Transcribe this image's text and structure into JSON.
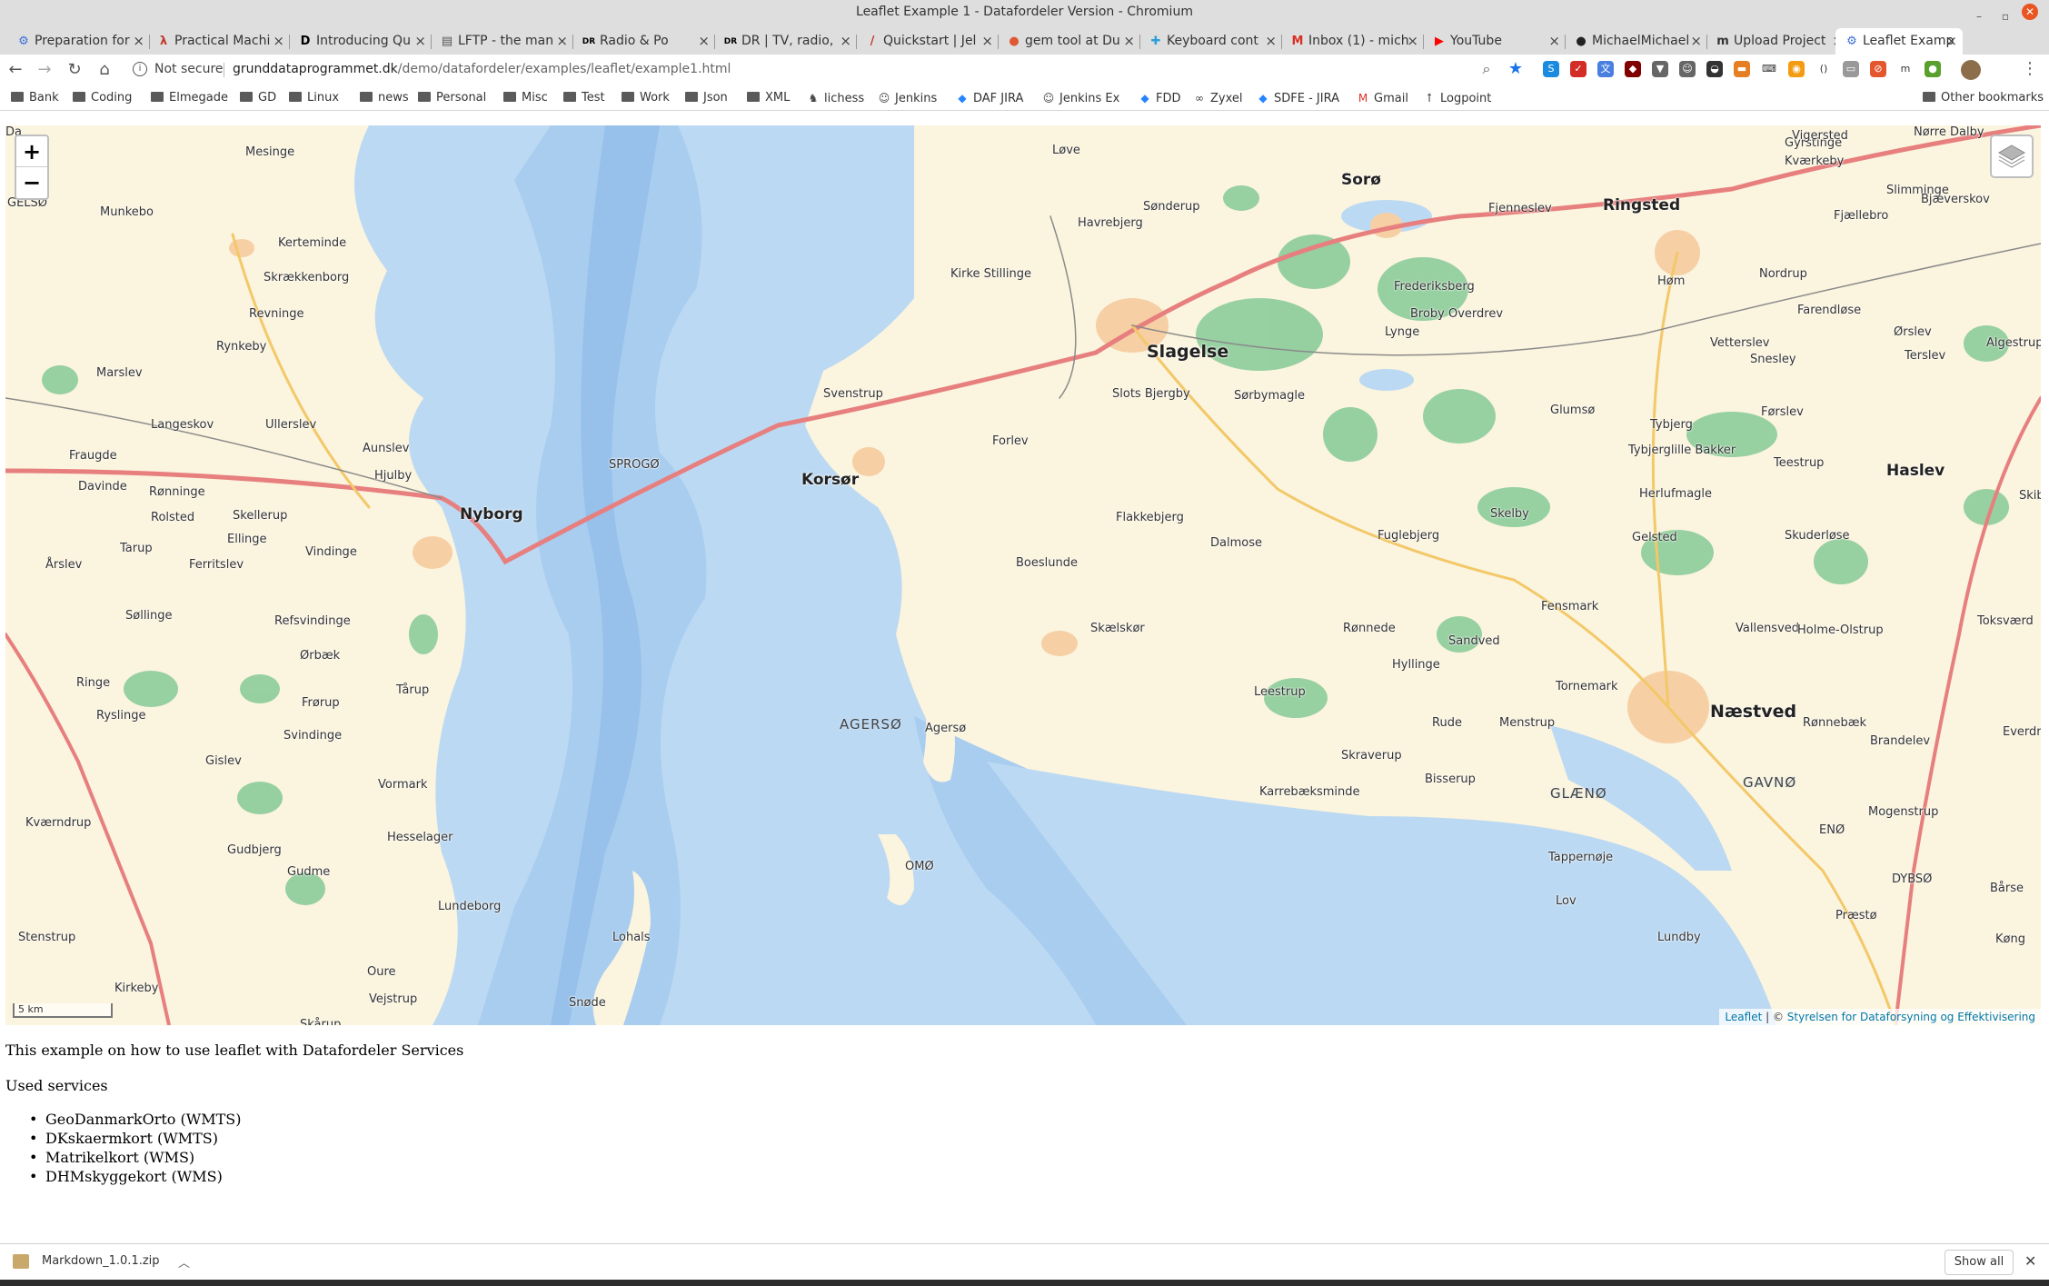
{
  "window": {
    "title": "Leaflet Example 1 - Datafordeler Version - Chromium"
  },
  "tabs": [
    {
      "label": "Preparation for",
      "icon": "gear-icon",
      "icon_glyph": "⚙",
      "icon_color": "#3b6fd8"
    },
    {
      "label": "Practical Machi",
      "icon": "lambda-icon",
      "icon_glyph": "λ",
      "icon_color": "#c0392b"
    },
    {
      "label": "Introducing Qu",
      "icon": "dev-icon",
      "icon_glyph": "D",
      "icon_color": "#000000"
    },
    {
      "label": "LFTP - the man",
      "icon": "terminal-icon",
      "icon_glyph": "▤",
      "icon_color": "#555555"
    },
    {
      "label": "Radio & Po",
      "icon": "dr-icon",
      "icon_glyph": "DR",
      "icon_color": "#000000"
    },
    {
      "label": "DR | TV, radio,",
      "icon": "dr-icon",
      "icon_glyph": "DR",
      "icon_color": "#000000"
    },
    {
      "label": "Quickstart | Jel",
      "icon": "jekyll-icon",
      "icon_glyph": "/",
      "icon_color": "#c0392b"
    },
    {
      "label": "gem tool at Du",
      "icon": "duckduckgo-icon",
      "icon_glyph": "●",
      "icon_color": "#de5833"
    },
    {
      "label": "Keyboard cont",
      "icon": "puzzle-icon",
      "icon_glyph": "✚",
      "icon_color": "#2b9fd8"
    },
    {
      "label": "Inbox (1) - mich",
      "icon": "gmail-icon",
      "icon_glyph": "M",
      "icon_color": "#d93025"
    },
    {
      "label": "YouTube",
      "icon": "youtube-icon",
      "icon_glyph": "▶",
      "icon_color": "#ff0000"
    },
    {
      "label": "MichaelMichael",
      "icon": "github-icon",
      "icon_glyph": "●",
      "icon_color": "#222222"
    },
    {
      "label": "Upload Project",
      "icon": "upload-icon",
      "icon_glyph": "m",
      "icon_color": "#333333"
    },
    {
      "label": "Leaflet Examp",
      "icon": "gear-icon",
      "icon_glyph": "⚙",
      "icon_color": "#3b6fd8",
      "active": true
    }
  ],
  "address": {
    "security_label": "Not secure",
    "host": "grunddataprogrammet.dk",
    "path": "/demo/datafordeler/examples/leaflet/example1.html"
  },
  "extensions": [
    {
      "name": "skype-icon",
      "color": "#1b8be0",
      "glyph": "S"
    },
    {
      "name": "lastpass-icon",
      "color": "#d32d27",
      "glyph": "✓"
    },
    {
      "name": "translate-icon",
      "color": "#4a7fe0",
      "glyph": "文"
    },
    {
      "name": "ublock-icon",
      "color": "#800000",
      "glyph": "◆"
    },
    {
      "name": "filter-icon",
      "color": "#666666",
      "glyph": "▼"
    },
    {
      "name": "profile-icon",
      "color": "#666666",
      "glyph": "☺"
    },
    {
      "name": "shield-icon",
      "color": "#333333",
      "glyph": "◒"
    },
    {
      "name": "rss-icon",
      "color": "#e67e22",
      "glyph": "▬"
    },
    {
      "name": "ruler-icon",
      "color": "#ffffff",
      "glyph": "⌨"
    },
    {
      "name": "feed-icon",
      "color": "#f39c12",
      "glyph": "◉"
    },
    {
      "name": "brackets-icon",
      "color": "#ffffff",
      "glyph": "()"
    },
    {
      "name": "folder-icon",
      "color": "#999999",
      "glyph": "▭"
    },
    {
      "name": "block-icon",
      "color": "#e4572e",
      "glyph": "⊘"
    },
    {
      "name": "m-icon",
      "color": "#ffffff",
      "glyph": "m"
    },
    {
      "name": "green-icon",
      "color": "#5aa02c",
      "glyph": "●"
    }
  ],
  "bookmarks": [
    {
      "label": "Bank",
      "type": "folder"
    },
    {
      "label": "Coding",
      "type": "folder"
    },
    {
      "label": "Elmegade",
      "type": "folder"
    },
    {
      "label": "GD",
      "type": "folder"
    },
    {
      "label": "Linux",
      "type": "folder"
    },
    {
      "label": "news",
      "type": "folder"
    },
    {
      "label": "Personal",
      "type": "folder"
    },
    {
      "label": "Misc",
      "type": "folder"
    },
    {
      "label": "Test",
      "type": "folder"
    },
    {
      "label": "Work",
      "type": "folder"
    },
    {
      "label": "Json",
      "type": "folder"
    },
    {
      "label": "XML",
      "type": "folder"
    },
    {
      "label": "lichess",
      "type": "link",
      "glyph": "♞"
    },
    {
      "label": "Jenkins",
      "type": "link",
      "glyph": "☺"
    },
    {
      "label": "DAF JIRA",
      "type": "link",
      "glyph": "◆"
    },
    {
      "label": "Jenkins Ex",
      "type": "link",
      "glyph": "☺"
    },
    {
      "label": "FDD",
      "type": "link",
      "glyph": "◆"
    },
    {
      "label": "Zyxel",
      "type": "link",
      "glyph": "∞"
    },
    {
      "label": "SDFE - JIRA",
      "type": "link",
      "glyph": "◆"
    },
    {
      "label": "Gmail",
      "type": "link",
      "glyph": "M"
    },
    {
      "label": "Logpoint",
      "type": "link",
      "glyph": "ꝉ"
    }
  ],
  "other_bookmarks": "Other bookmarks",
  "map": {
    "zoom_in": "+",
    "zoom_out": "−",
    "scale": "5 km",
    "attribution_link": "Leaflet",
    "attribution_sep": " | © ",
    "attribution_owner": "Styrelsen for Dataforsyning og Effektivisering",
    "labels": [
      {
        "text": "Mesinge",
        "class": ""
      },
      {
        "text": "GELSØ",
        "class": ""
      },
      {
        "text": "Munkebo",
        "class": ""
      },
      {
        "text": "Kerteminde",
        "class": ""
      },
      {
        "text": "Skrækkenborg",
        "class": ""
      },
      {
        "text": "Revninge",
        "class": ""
      },
      {
        "text": "Rynkeby",
        "class": ""
      },
      {
        "text": "Marslev",
        "class": ""
      },
      {
        "text": "Langeskov",
        "class": ""
      },
      {
        "text": "Ullerslev",
        "class": ""
      },
      {
        "text": "Aunslev",
        "class": ""
      },
      {
        "text": "Hjulby",
        "class": ""
      },
      {
        "text": "Fraugde",
        "class": ""
      },
      {
        "text": "Davinde",
        "class": ""
      },
      {
        "text": "Rønninge",
        "class": ""
      },
      {
        "text": "Rolsted",
        "class": ""
      },
      {
        "text": "Skellerup",
        "class": ""
      },
      {
        "text": "Ellinge",
        "class": ""
      },
      {
        "text": "Tarup",
        "class": ""
      },
      {
        "text": "Vindinge",
        "class": ""
      },
      {
        "text": "Nyborg",
        "class": "town"
      },
      {
        "text": "Årslev",
        "class": ""
      },
      {
        "text": "Ferritslev",
        "class": ""
      },
      {
        "text": "Søllinge",
        "class": ""
      },
      {
        "text": "Refsvindinge",
        "class": ""
      },
      {
        "text": "Ørbæk",
        "class": ""
      },
      {
        "text": "Ringe",
        "class": ""
      },
      {
        "text": "Tårup",
        "class": ""
      },
      {
        "text": "Frørup",
        "class": ""
      },
      {
        "text": "Ryslinge",
        "class": ""
      },
      {
        "text": "Svindinge",
        "class": ""
      },
      {
        "text": "Gislev",
        "class": ""
      },
      {
        "text": "Vormark",
        "class": ""
      },
      {
        "text": "Kværndrup",
        "class": ""
      },
      {
        "text": "Hesselager",
        "class": ""
      },
      {
        "text": "Gudbjerg",
        "class": ""
      },
      {
        "text": "Gudme",
        "class": ""
      },
      {
        "text": "Lundeborg",
        "class": ""
      },
      {
        "text": "Stenstrup",
        "class": ""
      },
      {
        "text": "Oure",
        "class": ""
      },
      {
        "text": "Kirkeby",
        "class": ""
      },
      {
        "text": "Vejstrup",
        "class": ""
      },
      {
        "text": "Skårup",
        "class": ""
      },
      {
        "text": "SPROGØ",
        "class": ""
      },
      {
        "text": "Svenstrup",
        "class": ""
      },
      {
        "text": "Korsør",
        "class": "town"
      },
      {
        "text": "Løve",
        "class": ""
      },
      {
        "text": "Kirke Stillinge",
        "class": ""
      },
      {
        "text": "Havrebjerg",
        "class": ""
      },
      {
        "text": "Sønderup",
        "class": ""
      },
      {
        "text": "Slagelse",
        "class": "city"
      },
      {
        "text": "Slots Bjergby",
        "class": ""
      },
      {
        "text": "Forlev",
        "class": ""
      },
      {
        "text": "Sørbymagle",
        "class": ""
      },
      {
        "text": "Flakkebjerg",
        "class": ""
      },
      {
        "text": "Boeslunde",
        "class": ""
      },
      {
        "text": "Dalmose",
        "class": ""
      },
      {
        "text": "Skælskør",
        "class": ""
      },
      {
        "text": "AGERSØ",
        "class": "island"
      },
      {
        "text": "Agersø",
        "class": ""
      },
      {
        "text": "OMØ",
        "class": ""
      },
      {
        "text": "Lohals",
        "class": ""
      },
      {
        "text": "Snøde",
        "class": ""
      },
      {
        "text": "Gyrstinge",
        "class": ""
      },
      {
        "text": "Sorø",
        "class": "town"
      },
      {
        "text": "Fjenneslev",
        "class": ""
      },
      {
        "text": "Frederiksberg",
        "class": ""
      },
      {
        "text": "Broby Overdrev",
        "class": ""
      },
      {
        "text": "Lynge",
        "class": ""
      },
      {
        "text": "Ringsted",
        "class": "town"
      },
      {
        "text": "Høm",
        "class": ""
      },
      {
        "text": "Vigersted",
        "class": ""
      },
      {
        "text": "Kværkeby",
        "class": ""
      },
      {
        "text": "Nørre Dalby",
        "class": ""
      },
      {
        "text": "Slimminge",
        "class": ""
      },
      {
        "text": "Fjællebro",
        "class": ""
      },
      {
        "text": "Bjæverskov",
        "class": ""
      },
      {
        "text": "Nordrup",
        "class": ""
      },
      {
        "text": "Farendløse",
        "class": ""
      },
      {
        "text": "Vetterslev",
        "class": ""
      },
      {
        "text": "Ørslev",
        "class": ""
      },
      {
        "text": "Algestrup",
        "class": ""
      },
      {
        "text": "Terslev",
        "class": ""
      },
      {
        "text": "Snesley",
        "class": ""
      },
      {
        "text": "Glumsø",
        "class": ""
      },
      {
        "text": "Tybjerg",
        "class": ""
      },
      {
        "text": "Tybjerglille Bakker",
        "class": ""
      },
      {
        "text": "Teestrup",
        "class": ""
      },
      {
        "text": "Førslev",
        "class": ""
      },
      {
        "text": "Haslev",
        "class": "town"
      },
      {
        "text": "Herlufmagle",
        "class": ""
      },
      {
        "text": "Skelby",
        "class": ""
      },
      {
        "text": "Fuglebjerg",
        "class": ""
      },
      {
        "text": "Gelsted",
        "class": ""
      },
      {
        "text": "Skuderløse",
        "class": ""
      },
      {
        "text": "Fensmark",
        "class": ""
      },
      {
        "text": "Vallensved",
        "class": ""
      },
      {
        "text": "Holme-Olstrup",
        "class": ""
      },
      {
        "text": "Toksværd",
        "class": ""
      },
      {
        "text": "Rønnede",
        "class": ""
      },
      {
        "text": "Sandved",
        "class": ""
      },
      {
        "text": "Hyllinge",
        "class": ""
      },
      {
        "text": "Tornemark",
        "class": ""
      },
      {
        "text": "Næstved",
        "class": "city"
      },
      {
        "text": "Rønnebæk",
        "class": ""
      },
      {
        "text": "Brandelev",
        "class": ""
      },
      {
        "text": "Everdrup",
        "class": ""
      },
      {
        "text": "Leestrup",
        "class": ""
      },
      {
        "text": "Rude",
        "class": ""
      },
      {
        "text": "Menstrup",
        "class": ""
      },
      {
        "text": "Skraverup",
        "class": ""
      },
      {
        "text": "Bisserup",
        "class": ""
      },
      {
        "text": "Karrebæksminde",
        "class": ""
      },
      {
        "text": "GLÆNØ",
        "class": "island"
      },
      {
        "text": "GAVNØ",
        "class": "island"
      },
      {
        "text": "Mogenstrup",
        "class": ""
      },
      {
        "text": "Tappernøje",
        "class": ""
      },
      {
        "text": "ENØ",
        "class": ""
      },
      {
        "text": "Lov",
        "class": ""
      },
      {
        "text": "DYBSØ",
        "class": ""
      },
      {
        "text": "Bårse",
        "class": ""
      },
      {
        "text": "Præstø",
        "class": ""
      },
      {
        "text": "Lundby",
        "class": ""
      },
      {
        "text": "Køng",
        "class": ""
      },
      {
        "text": "Skibinge",
        "class": ""
      },
      {
        "text": "Da",
        "class": ""
      }
    ]
  },
  "content": {
    "intro": "This example on how to use leaflet with Datafordeler Services",
    "used_services": "Used services",
    "services": [
      "GeoDanmarkOrto (WMTS)",
      "DKskaermkort (WMTS)",
      "Matrikelkort (WMS)",
      "DHMskyggekort (WMS)"
    ]
  },
  "downloads": {
    "file": "Markdown_1.0.1.zip",
    "show_all": "Show all"
  }
}
